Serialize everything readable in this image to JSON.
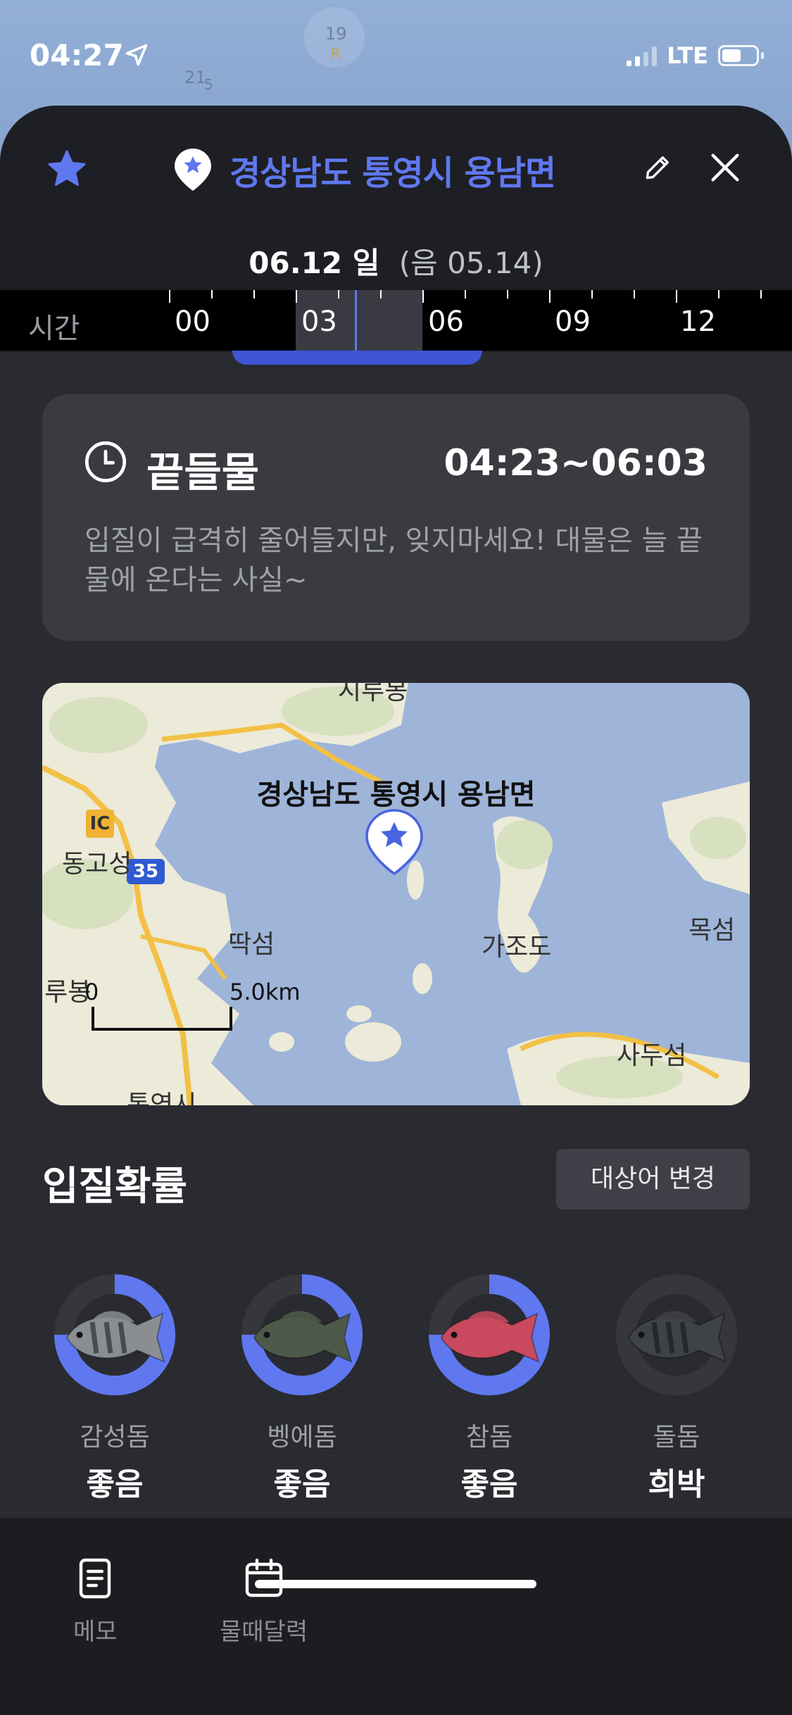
{
  "status_bar": {
    "time": "04:27",
    "network": "LTE"
  },
  "map_background": {
    "road_num_1": "19",
    "road_num_1_sub": "R",
    "road_num_2": "21",
    "road_num_2_sub": "5"
  },
  "header": {
    "title": "경상남도 통영시 용남면",
    "date": "06.12 일",
    "lunar": "(음  05.14)",
    "accent_color": "#5f78f0"
  },
  "timeline": {
    "label": "시간",
    "hours": [
      "00",
      "03",
      "06",
      "09",
      "12"
    ]
  },
  "tide_card": {
    "title": "끝들물",
    "time_range": "04:23~06:03",
    "description": "입질이 급격히 줄어들지만, 잊지마세요! 대물은 늘 끝물에 온다는 사실~"
  },
  "map": {
    "title": "경상남도 통영시 용남면",
    "places": {
      "p1": "동고성",
      "p2": "딱섬",
      "p3": "가조도",
      "p4": "목섬",
      "p5": "사두섬",
      "p6": "리루봉",
      "p7": "통영시",
      "p8": "시루봉"
    },
    "ic_badge": "IC",
    "highway_badge": "35",
    "scale_start": "0",
    "scale_end": "5.0km"
  },
  "bite_section": {
    "title": "입질확률",
    "change_button": "대상어 변경",
    "fish": [
      {
        "name": "감성돔",
        "status": "좋음",
        "level": 0.75,
        "body_color": "#8a8e92",
        "stripe": true
      },
      {
        "name": "벵에돔",
        "status": "좋음",
        "level": 0.75,
        "body_color": "#4d5a4a",
        "stripe": false
      },
      {
        "name": "참돔",
        "status": "좋음",
        "level": 0.75,
        "body_color": "#c94a5e",
        "stripe": false
      },
      {
        "name": "돌돔",
        "status": "희박",
        "level": 0.0,
        "body_color": "#3f4246",
        "stripe": true
      }
    ]
  },
  "bottom_nav": {
    "memo": "메모",
    "tide_calendar": "물때달력"
  }
}
